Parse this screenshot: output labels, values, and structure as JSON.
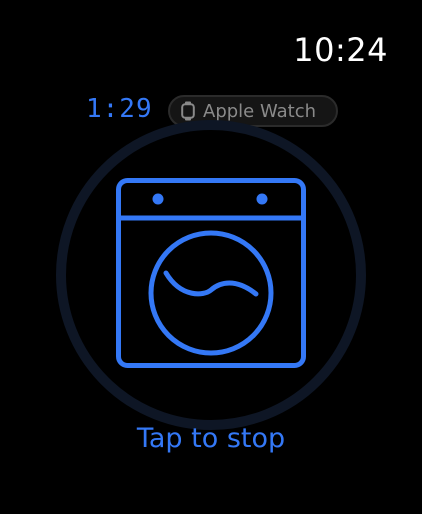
{
  "status_bar": {
    "time": "10:24"
  },
  "session": {
    "elapsed": "1:29",
    "device": {
      "icon": "watch-icon",
      "label": "Apple Watch"
    }
  },
  "activity": {
    "icon": "washing-machine-icon",
    "action_hint": "Tap to stop"
  },
  "colors": {
    "accent": "#3478f6",
    "ring": "#0e1625",
    "background": "#000000",
    "chip_text": "#8a8a8a"
  }
}
